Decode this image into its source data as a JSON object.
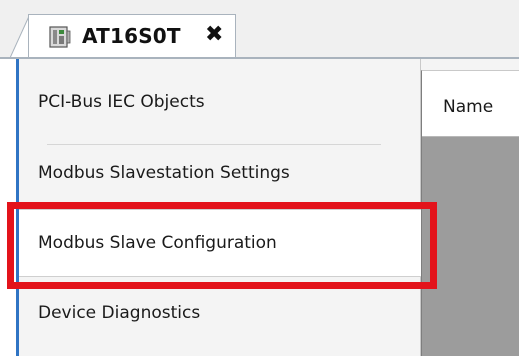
{
  "tab": {
    "title": "AT16S0T",
    "close_glyph": "✖",
    "icon": "device-icon"
  },
  "sidebar": {
    "items": [
      {
        "label": "PCI-Bus IEC Objects",
        "selected": false
      },
      {
        "label": "Modbus Slavestation Settings",
        "selected": false
      },
      {
        "label": "Modbus Slave Configuration",
        "selected": true
      },
      {
        "label": "Device Diagnostics",
        "selected": false
      }
    ]
  },
  "table": {
    "columns": [
      "Name"
    ]
  },
  "colors": {
    "highlight": "#e3131b",
    "accent": "#2f74c4"
  }
}
